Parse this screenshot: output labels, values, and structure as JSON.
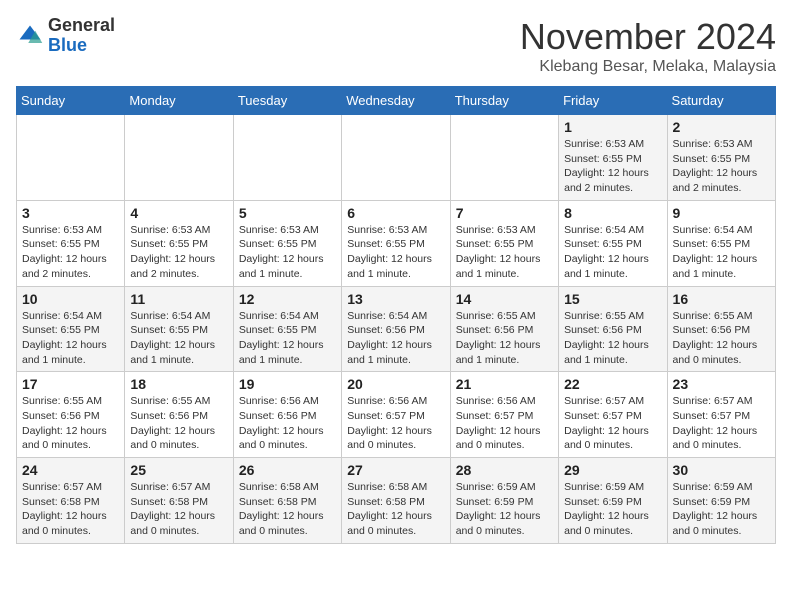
{
  "header": {
    "logo": {
      "line1": "General",
      "line2": "Blue"
    },
    "title": "November 2024",
    "location": "Klebang Besar, Melaka, Malaysia"
  },
  "weekdays": [
    "Sunday",
    "Monday",
    "Tuesday",
    "Wednesday",
    "Thursday",
    "Friday",
    "Saturday"
  ],
  "weeks": [
    [
      {
        "day": "",
        "info": ""
      },
      {
        "day": "",
        "info": ""
      },
      {
        "day": "",
        "info": ""
      },
      {
        "day": "",
        "info": ""
      },
      {
        "day": "",
        "info": ""
      },
      {
        "day": "1",
        "info": "Sunrise: 6:53 AM\nSunset: 6:55 PM\nDaylight: 12 hours and 2 minutes."
      },
      {
        "day": "2",
        "info": "Sunrise: 6:53 AM\nSunset: 6:55 PM\nDaylight: 12 hours and 2 minutes."
      }
    ],
    [
      {
        "day": "3",
        "info": "Sunrise: 6:53 AM\nSunset: 6:55 PM\nDaylight: 12 hours and 2 minutes."
      },
      {
        "day": "4",
        "info": "Sunrise: 6:53 AM\nSunset: 6:55 PM\nDaylight: 12 hours and 2 minutes."
      },
      {
        "day": "5",
        "info": "Sunrise: 6:53 AM\nSunset: 6:55 PM\nDaylight: 12 hours and 1 minute."
      },
      {
        "day": "6",
        "info": "Sunrise: 6:53 AM\nSunset: 6:55 PM\nDaylight: 12 hours and 1 minute."
      },
      {
        "day": "7",
        "info": "Sunrise: 6:53 AM\nSunset: 6:55 PM\nDaylight: 12 hours and 1 minute."
      },
      {
        "day": "8",
        "info": "Sunrise: 6:54 AM\nSunset: 6:55 PM\nDaylight: 12 hours and 1 minute."
      },
      {
        "day": "9",
        "info": "Sunrise: 6:54 AM\nSunset: 6:55 PM\nDaylight: 12 hours and 1 minute."
      }
    ],
    [
      {
        "day": "10",
        "info": "Sunrise: 6:54 AM\nSunset: 6:55 PM\nDaylight: 12 hours and 1 minute."
      },
      {
        "day": "11",
        "info": "Sunrise: 6:54 AM\nSunset: 6:55 PM\nDaylight: 12 hours and 1 minute."
      },
      {
        "day": "12",
        "info": "Sunrise: 6:54 AM\nSunset: 6:55 PM\nDaylight: 12 hours and 1 minute."
      },
      {
        "day": "13",
        "info": "Sunrise: 6:54 AM\nSunset: 6:56 PM\nDaylight: 12 hours and 1 minute."
      },
      {
        "day": "14",
        "info": "Sunrise: 6:55 AM\nSunset: 6:56 PM\nDaylight: 12 hours and 1 minute."
      },
      {
        "day": "15",
        "info": "Sunrise: 6:55 AM\nSunset: 6:56 PM\nDaylight: 12 hours and 1 minute."
      },
      {
        "day": "16",
        "info": "Sunrise: 6:55 AM\nSunset: 6:56 PM\nDaylight: 12 hours and 0 minutes."
      }
    ],
    [
      {
        "day": "17",
        "info": "Sunrise: 6:55 AM\nSunset: 6:56 PM\nDaylight: 12 hours and 0 minutes."
      },
      {
        "day": "18",
        "info": "Sunrise: 6:55 AM\nSunset: 6:56 PM\nDaylight: 12 hours and 0 minutes."
      },
      {
        "day": "19",
        "info": "Sunrise: 6:56 AM\nSunset: 6:56 PM\nDaylight: 12 hours and 0 minutes."
      },
      {
        "day": "20",
        "info": "Sunrise: 6:56 AM\nSunset: 6:57 PM\nDaylight: 12 hours and 0 minutes."
      },
      {
        "day": "21",
        "info": "Sunrise: 6:56 AM\nSunset: 6:57 PM\nDaylight: 12 hours and 0 minutes."
      },
      {
        "day": "22",
        "info": "Sunrise: 6:57 AM\nSunset: 6:57 PM\nDaylight: 12 hours and 0 minutes."
      },
      {
        "day": "23",
        "info": "Sunrise: 6:57 AM\nSunset: 6:57 PM\nDaylight: 12 hours and 0 minutes."
      }
    ],
    [
      {
        "day": "24",
        "info": "Sunrise: 6:57 AM\nSunset: 6:58 PM\nDaylight: 12 hours and 0 minutes."
      },
      {
        "day": "25",
        "info": "Sunrise: 6:57 AM\nSunset: 6:58 PM\nDaylight: 12 hours and 0 minutes."
      },
      {
        "day": "26",
        "info": "Sunrise: 6:58 AM\nSunset: 6:58 PM\nDaylight: 12 hours and 0 minutes."
      },
      {
        "day": "27",
        "info": "Sunrise: 6:58 AM\nSunset: 6:58 PM\nDaylight: 12 hours and 0 minutes."
      },
      {
        "day": "28",
        "info": "Sunrise: 6:59 AM\nSunset: 6:59 PM\nDaylight: 12 hours and 0 minutes."
      },
      {
        "day": "29",
        "info": "Sunrise: 6:59 AM\nSunset: 6:59 PM\nDaylight: 12 hours and 0 minutes."
      },
      {
        "day": "30",
        "info": "Sunrise: 6:59 AM\nSunset: 6:59 PM\nDaylight: 12 hours and 0 minutes."
      }
    ]
  ]
}
